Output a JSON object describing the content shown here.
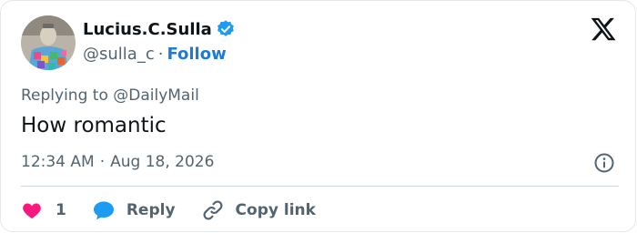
{
  "author": {
    "name": "Lucius.C.Sulla",
    "handle": "@sulla_c",
    "separator": "·",
    "follow_label": "Follow",
    "verified": true
  },
  "reply_context": {
    "prefix": "Replying to ",
    "target": "@DailyMail"
  },
  "tweet": {
    "text": "How romantic",
    "time": "12:34 AM",
    "separator": "·",
    "date": "Aug 18, 2026"
  },
  "actions": {
    "like_count": "1",
    "reply_label": "Reply",
    "copy_link_label": "Copy link"
  },
  "colors": {
    "accent": "#1d7bd8",
    "like": "#f91880",
    "reply_bubble": "#1d9bf0",
    "secondary_text": "#536471",
    "primary_text": "#0f1419",
    "divider": "#cfd9de"
  },
  "icons": {
    "verified": "verified-badge-icon",
    "platform": "x-logo-icon",
    "info": "info-icon",
    "like": "heart-icon",
    "reply": "speech-bubble-icon",
    "copy": "link-icon"
  }
}
